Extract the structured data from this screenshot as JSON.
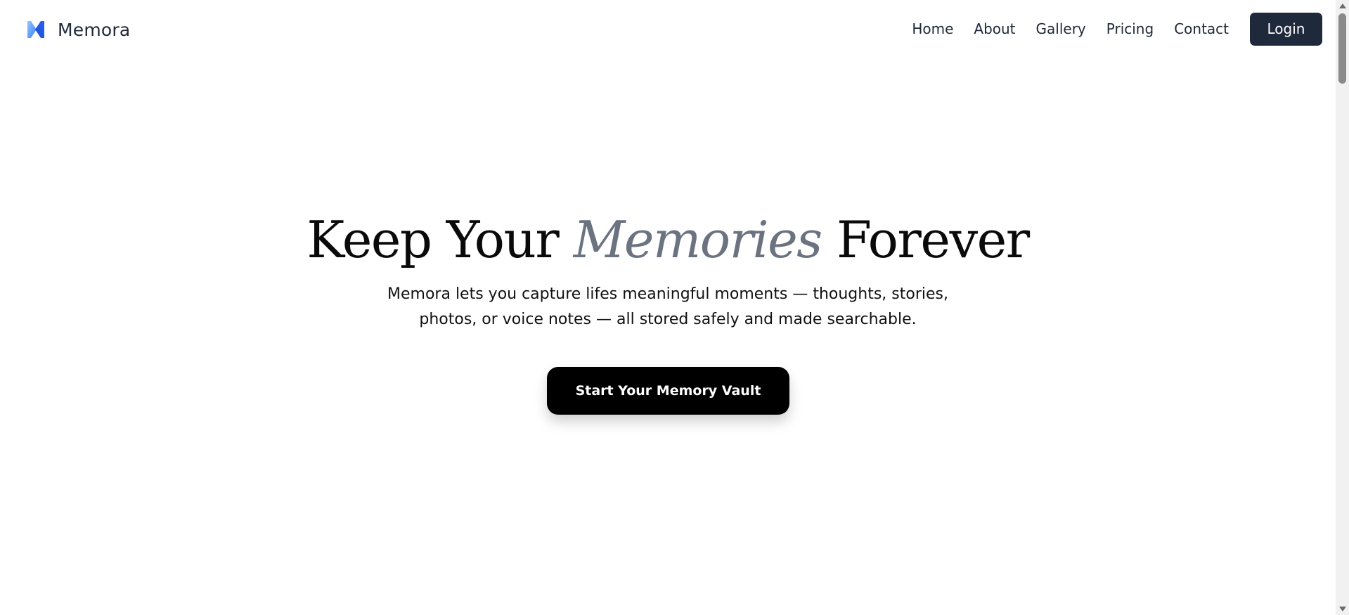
{
  "header": {
    "brand": {
      "name": "Memora",
      "logo_icon": "memora-logo-icon",
      "logo_colors": [
        "#60a5fa",
        "#2563eb"
      ]
    },
    "nav": {
      "items": [
        {
          "label": "Home"
        },
        {
          "label": "About"
        },
        {
          "label": "Gallery"
        },
        {
          "label": "Pricing"
        },
        {
          "label": "Contact"
        }
      ],
      "login_label": "Login"
    }
  },
  "hero": {
    "title_before": "Keep Your ",
    "title_accent": "Memories",
    "title_after": " Forever",
    "subtitle_line1": "Memora lets you capture lifes meaningful moments — thoughts, stories,",
    "subtitle_line2": "photos, or voice notes — all stored safely and made searchable.",
    "cta_label": "Start Your Memory Vault"
  },
  "colors": {
    "login_bg": "#1e293b",
    "cta_bg": "#000000",
    "accent_text": "#6b7280"
  },
  "scrollbar": {
    "up_icon": "scroll-up-arrow-icon",
    "down_icon": "scroll-down-arrow-icon"
  }
}
